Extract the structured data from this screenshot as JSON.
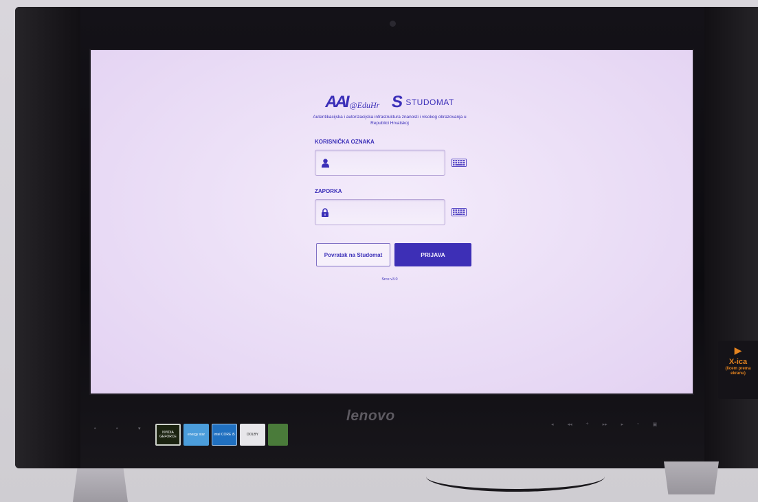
{
  "login": {
    "aai_logo": "AAI@EduHr",
    "studomat_logo": "STUDOMAT",
    "subtitle": "Autentikacijska i autorizacijska infrastruktura znanosti i visokog obrazovanja u Republici Hrvatskoj",
    "username_label": "KORISNIČKA OZNAKA",
    "username_value": "",
    "password_label": "ZAPORKA",
    "password_value": "",
    "back_button": "Povratak na Studomat",
    "login_button": "PRIJAVA",
    "version": "Srce v3.0"
  },
  "device": {
    "brand": "lenovo",
    "stickers": [
      "NVIDIA GEFORCE",
      "energy star",
      "intel CORE i5",
      "DOLBY",
      ""
    ]
  },
  "xica": {
    "title": "X-ica",
    "note": "(licem prema ekranu)"
  },
  "icons": {
    "user": "user-icon",
    "lock": "lock-icon",
    "keyboard": "keyboard-icon",
    "arrow": "play-arrow-icon"
  },
  "colors": {
    "accent": "#3b2fb8",
    "screen_bg": "#ece0f7",
    "login_button_bg": "#3d2fb6"
  }
}
